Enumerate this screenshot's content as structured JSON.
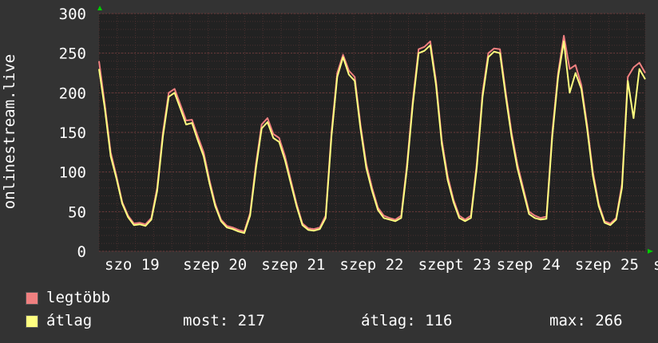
{
  "chart_data": {
    "type": "line",
    "ylabel": "onlinestream.live",
    "ylim": [
      0,
      300
    ],
    "yticks": [
      "0",
      "50",
      "100",
      "150",
      "200",
      "250",
      "300"
    ],
    "xtick_labels": [
      "szo 19",
      "szep 20",
      "szep 21",
      "szep 22",
      "szept 23",
      "szep 24",
      "szep 25",
      "szo"
    ],
    "grid": true,
    "legend_placement": "bottom-left",
    "series": [
      {
        "name": "legtöbb",
        "color": "#f08080",
        "values": [
          240,
          185,
          125,
          95,
          62,
          45,
          35,
          36,
          34,
          42,
          80,
          150,
          200,
          205,
          185,
          165,
          166,
          145,
          125,
          90,
          60,
          40,
          32,
          30,
          27,
          25,
          48,
          110,
          160,
          168,
          148,
          143,
          120,
          90,
          60,
          35,
          29,
          28,
          30,
          45,
          150,
          225,
          248,
          228,
          220,
          160,
          110,
          80,
          55,
          45,
          42,
          40,
          45,
          110,
          190,
          255,
          258,
          265,
          215,
          140,
          95,
          65,
          45,
          40,
          45,
          110,
          200,
          250,
          256,
          255,
          200,
          150,
          110,
          80,
          50,
          45,
          42,
          44,
          150,
          225,
          272,
          230,
          235,
          210,
          160,
          100,
          60,
          38,
          35,
          42,
          85,
          220,
          232,
          238,
          225
        ]
      },
      {
        "name": "átlag",
        "color": "#ffff80",
        "values": [
          230,
          180,
          120,
          92,
          60,
          43,
          33,
          34,
          32,
          40,
          76,
          145,
          195,
          200,
          180,
          160,
          162,
          140,
          120,
          86,
          57,
          38,
          30,
          28,
          25,
          23,
          45,
          105,
          155,
          163,
          143,
          138,
          115,
          86,
          57,
          33,
          27,
          26,
          28,
          42,
          145,
          220,
          245,
          223,
          215,
          155,
          105,
          76,
          52,
          42,
          40,
          38,
          42,
          105,
          185,
          250,
          253,
          260,
          210,
          135,
          90,
          62,
          42,
          38,
          42,
          105,
          195,
          245,
          252,
          250,
          195,
          145,
          105,
          76,
          47,
          42,
          40,
          41,
          145,
          220,
          265,
          200,
          225,
          205,
          155,
          95,
          57,
          36,
          33,
          40,
          80,
          215,
          168,
          230,
          217
        ]
      }
    ]
  },
  "stats": {
    "now_label": "most: 217",
    "avg_label": "átlag: 116",
    "max_label": "max: 266"
  },
  "colors": {
    "background": "#333333",
    "plot": "#222222",
    "grid": "#5a3a3a",
    "text": "#ffffff",
    "arrow": "#00cc00"
  }
}
